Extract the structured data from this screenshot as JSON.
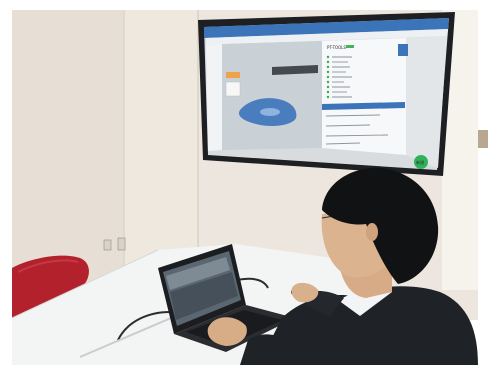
{
  "photo": {
    "subject": "",
    "colors": {
      "frame": "#ffffff",
      "wall_left": "#e6dfd7",
      "wall_center": "#ede7df",
      "wall_right_light": "#f3eee8",
      "table": "#f2f3f3",
      "chair_red": "#b2212b",
      "monitor_bezel": "#1d1f22",
      "screen_bg": "#d7dbde",
      "app_toolbar": "#3a73b8",
      "app_panel": "#f6f7f8",
      "model_blue": "#4c7fbf",
      "fab_green": "#2fb25a",
      "laptop": "#1c1d20",
      "suit": "#1f2226",
      "hair": "#111214",
      "skin": "#d9b08c",
      "shirt": "#f3f4f6"
    },
    "screen": {
      "right_panel_title": "PT-TOOLS",
      "fab_label": "新規"
    }
  }
}
